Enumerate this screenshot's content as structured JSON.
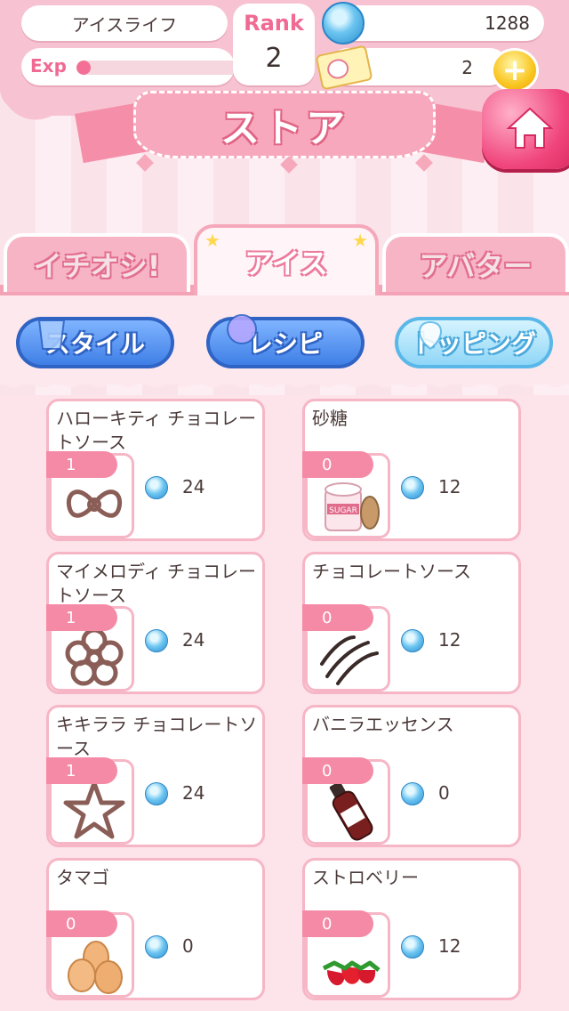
{
  "header": {
    "username": "アイスライフ",
    "exp_label": "Exp",
    "exp_progress": 0.08,
    "rank_label": "Rank",
    "rank_value": "2",
    "coins": "1288",
    "tickets": "2",
    "plus_symbol": "+"
  },
  "title": "ストア",
  "tabs": [
    {
      "label": "イチオシ!",
      "active": false
    },
    {
      "label": "アイス",
      "active": true
    },
    {
      "label": "アバター",
      "active": false
    }
  ],
  "sub_tabs": [
    {
      "label": "スタイル"
    },
    {
      "label": "レシピ"
    },
    {
      "label": "トッピング",
      "active": true
    }
  ],
  "items": [
    {
      "name": "ハローキティ チョコレートソース",
      "qty": "1",
      "price": "24",
      "icon": "bow-outline"
    },
    {
      "name": "砂糖",
      "qty": "0",
      "price": "12",
      "icon": "sugar-jar"
    },
    {
      "name": "マイメロディ チョコレートソース",
      "qty": "1",
      "price": "24",
      "icon": "flower-outline"
    },
    {
      "name": "チョコレートソース",
      "qty": "0",
      "price": "12",
      "icon": "chocolate-drizzle"
    },
    {
      "name": "キキララ チョコレートソース",
      "qty": "1",
      "price": "24",
      "icon": "star-outline"
    },
    {
      "name": "バニラエッセンス",
      "qty": "0",
      "price": "0",
      "icon": "vanilla-bottle"
    },
    {
      "name": "タマゴ",
      "qty": "0",
      "price": "0",
      "icon": "eggs"
    },
    {
      "name": "ストロベリー",
      "qty": "0",
      "price": "12",
      "icon": "strawberries"
    }
  ],
  "colors": {
    "accent_pink": "#f06a93",
    "card_border": "#f6b6c6",
    "qty_badge": "#f58aa6",
    "blue_button": "#3f7fe6"
  }
}
